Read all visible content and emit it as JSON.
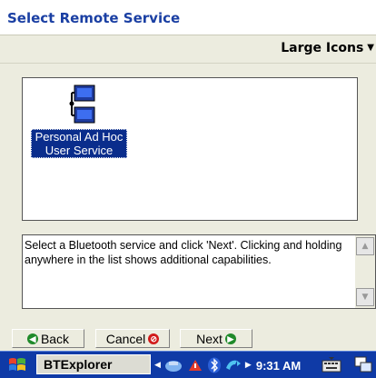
{
  "window": {
    "title": "Select Remote Service"
  },
  "view_menu": {
    "label": "Large Icons"
  },
  "services": [
    {
      "label_line1": "Personal Ad Hoc",
      "label_line2": "User Service",
      "icon": "computer-network-icon"
    }
  ],
  "help": {
    "text": "Select a Bluetooth service and click 'Next'.  Clicking and holding anywhere in the list shows additional capabilities."
  },
  "nav": {
    "back": "Back",
    "cancel": "Cancel",
    "next": "Next"
  },
  "taskbar": {
    "app_button": "BTExplorer",
    "time": "9:31 AM"
  },
  "colors": {
    "title": "#1a3fa3",
    "selection": "#0a2d8c",
    "taskbar": "#0f3aa6",
    "dialog_bg": "#ececdf"
  }
}
